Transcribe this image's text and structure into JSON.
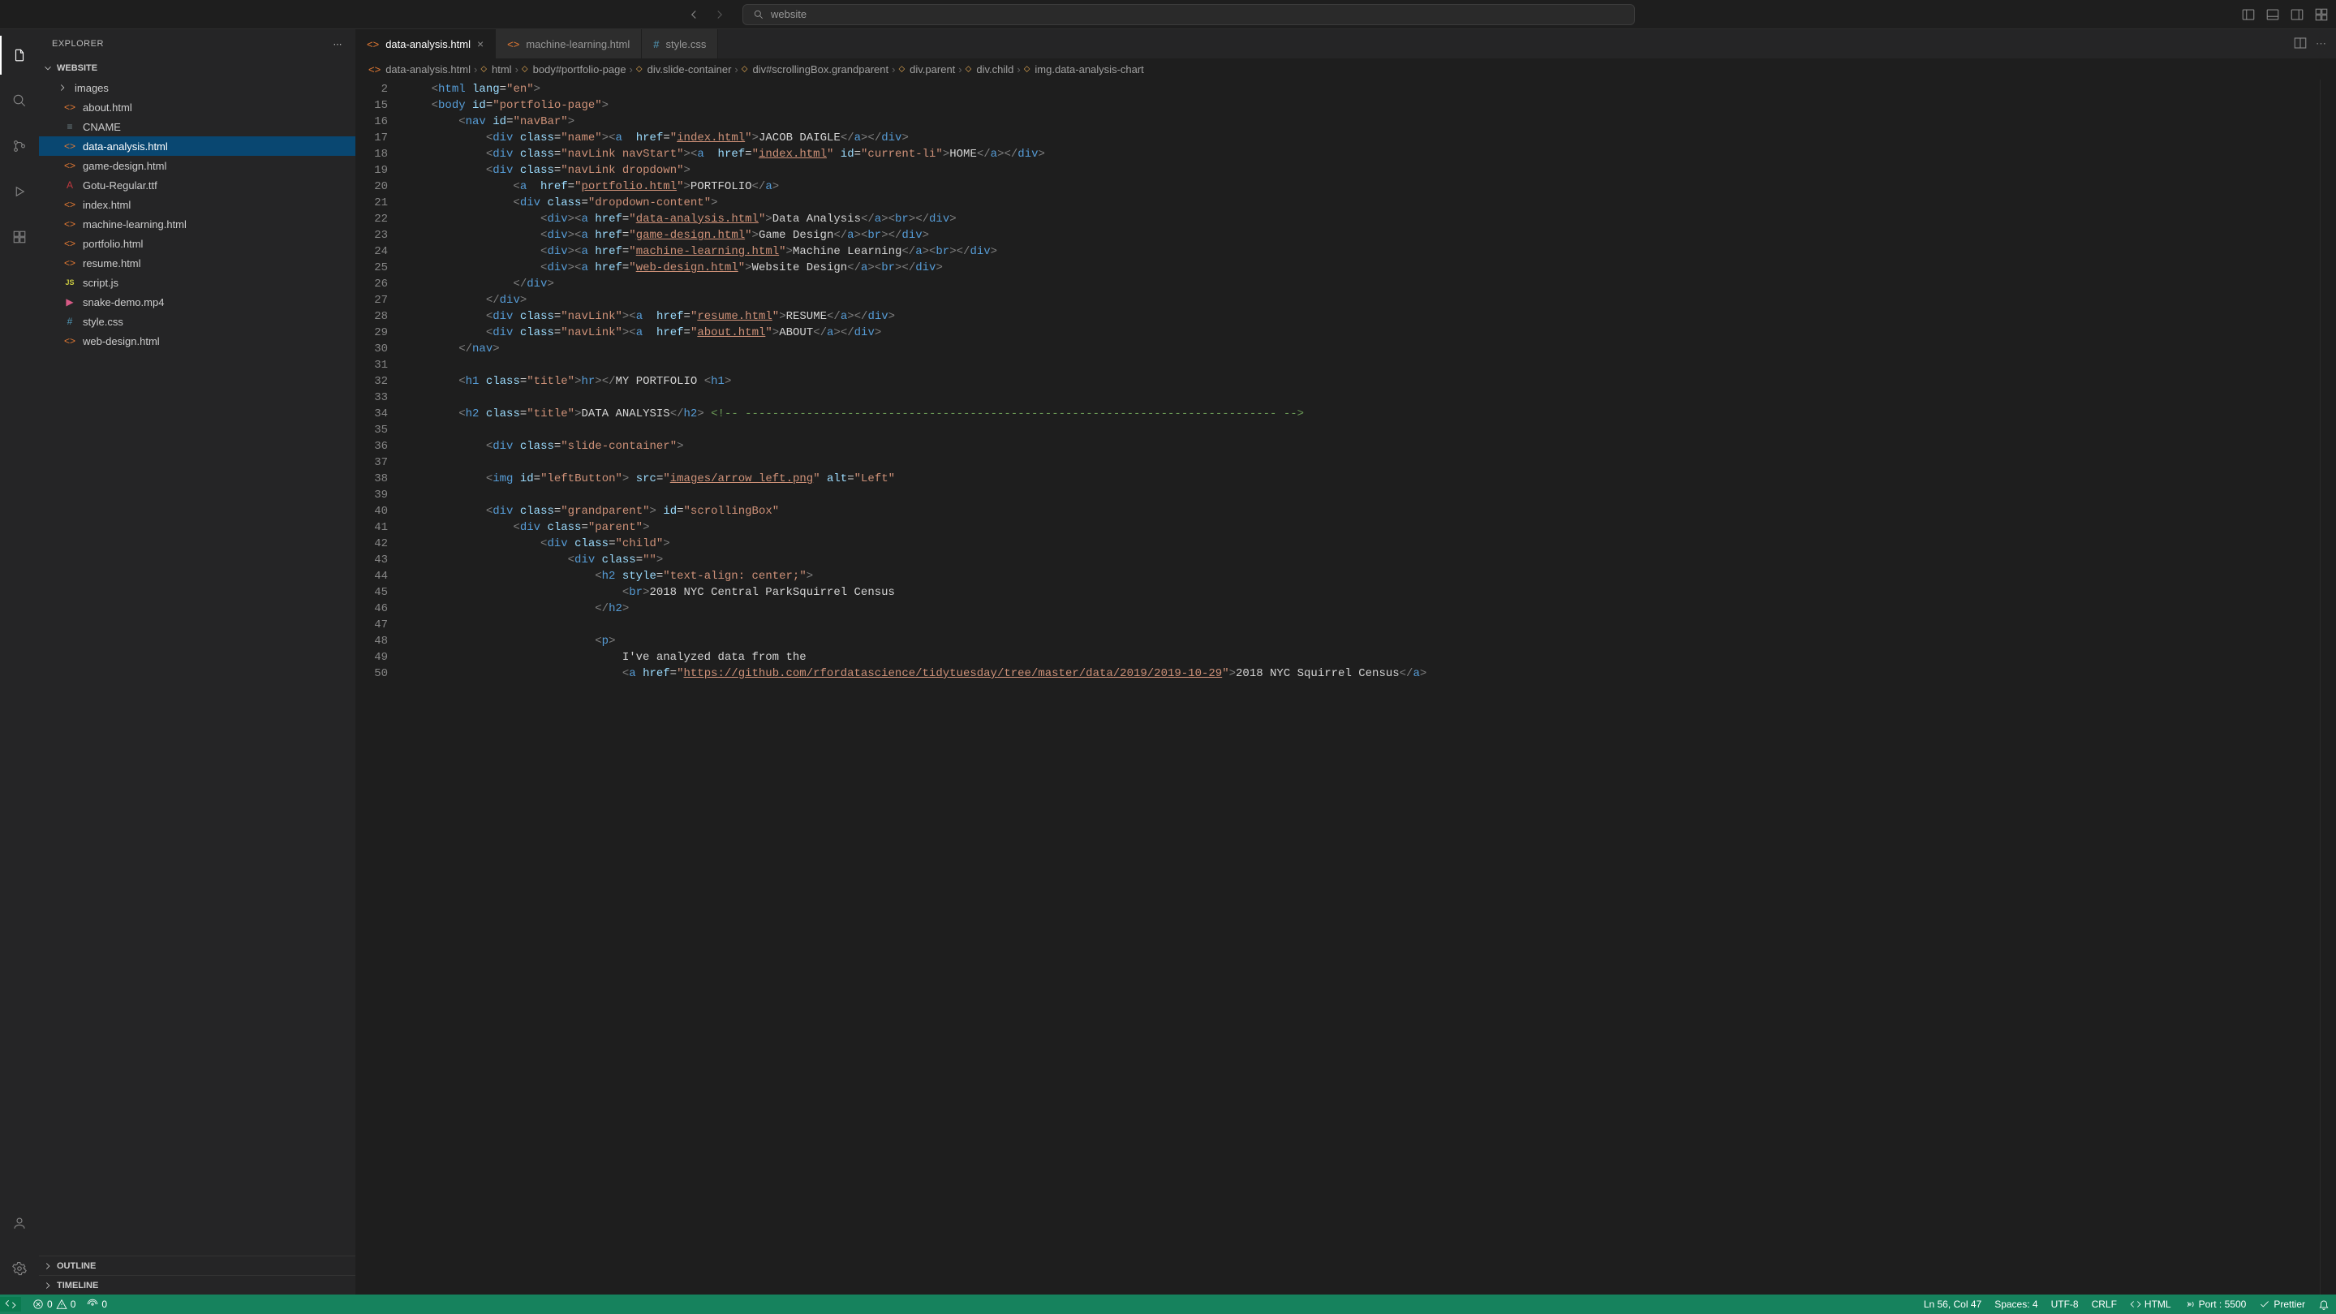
{
  "search_hint": "website",
  "explorer_label": "EXPLORER",
  "project": "WEBSITE",
  "folder_images": "images",
  "files": {
    "about": "about.html",
    "cname": "CNAME",
    "dataanalysis": "data-analysis.html",
    "gamedesign": "game-design.html",
    "gotu": "Gotu-Regular.ttf",
    "index": "index.html",
    "ml": "machine-learning.html",
    "portfolio": "portfolio.html",
    "resume": "resume.html",
    "script": "script.js",
    "snake": "snake-demo.mp4",
    "style": "style.css",
    "webdesign": "web-design.html"
  },
  "outline": "OUTLINE",
  "timeline": "TIMELINE",
  "tabs": {
    "t1": "data-analysis.html",
    "t2": "machine-learning.html",
    "t3": "style.css"
  },
  "breadcrumbs": {
    "b1": "data-analysis.html",
    "b2": "html",
    "b3": "body#portfolio-page",
    "b4": "div.slide-container",
    "b5": "div#scrollingBox.grandparent",
    "b6": "div.parent",
    "b7": "div.child",
    "b8": "img.data-analysis-chart"
  },
  "gutter": [
    "2",
    "15",
    "16",
    "17",
    "18",
    "19",
    "20",
    "21",
    "22",
    "23",
    "24",
    "25",
    "26",
    "27",
    "28",
    "29",
    "30",
    "31",
    "32",
    "33",
    "34",
    "35",
    "36",
    "37",
    "38",
    "39",
    "40",
    "41",
    "42",
    "43",
    "44",
    "45",
    "46",
    "47",
    "48",
    "49",
    "50"
  ],
  "code": {
    "l2": {
      "indent": "    ",
      "open": "<",
      "tag": "html",
      "sp": " ",
      "attr": "lang",
      "eq": "=",
      "val": "\"en\"",
      "close": ">"
    },
    "l15": {
      "indent": "    ",
      "open": "<",
      "tag": "body",
      "sp": " ",
      "attr": "id",
      "eq": "=",
      "val": "\"portfolio-page\"",
      "close": ">"
    },
    "l16": {
      "indent": "        ",
      "open": "<",
      "tag": "nav",
      "sp": " ",
      "attr": "id",
      "eq": "=",
      "val": "\"navBar\"",
      "close": ">"
    },
    "l17": {
      "indent": "            ",
      "s1": "<",
      "tag1": "div",
      "sp1": " ",
      "attr1": "class",
      "eq1": "=",
      "val1": "\"name\"",
      "c1": "><",
      "tag2": "a",
      "sp2": "  ",
      "attr2": "href",
      "eq2": "=",
      "val2": "\"",
      "link2": "index.html",
      "valEnd2": "\"",
      "c2": ">",
      "text": "JACOB DAIGLE",
      "close": "</",
      "tagc1": "a",
      "cc1": "></",
      "tagc2": "div",
      "cc2": ">"
    },
    "l18": {
      "indent": "            ",
      "s1": "<",
      "tag1": "div",
      "sp1": " ",
      "attr1": "class",
      "eq1": "=",
      "val1": "\"navLink navStart\"",
      "c1": "><",
      "tag2": "a",
      "sp2": "  ",
      "attr2": "href",
      "eq2": "=",
      "val2": "\"",
      "link2": "index.html",
      "valEnd2": "\"",
      "sp3": " ",
      "attr3": "id",
      "eq3": "=",
      "val3": "\"current-li\"",
      "c2": ">",
      "text": "HOME",
      "close": "</",
      "tagc1": "a",
      "cc1": "></",
      "tagc2": "div",
      "cc2": ">"
    },
    "l19": {
      "indent": "            ",
      "s1": "<",
      "tag1": "div",
      "sp1": " ",
      "attr1": "class",
      "eq1": "=",
      "val1": "\"navLink dropdown\"",
      "c1": ">"
    },
    "l20": {
      "indent": "                ",
      "s1": "<",
      "tag1": "a",
      "sp1": "  ",
      "attr1": "href",
      "eq1": "=",
      "val1": "\"",
      "link1": "portfolio.html",
      "valEnd1": "\"",
      "c1": ">",
      "text": "PORTFOLIO",
      "close": "</",
      "tagc1": "a",
      "cc1": ">"
    },
    "l21": {
      "indent": "                ",
      "s1": "<",
      "tag1": "div",
      "sp1": " ",
      "attr1": "class",
      "eq1": "=",
      "val1": "\"dropdown-content\"",
      "c1": ">"
    },
    "l22": {
      "indent": "                    ",
      "s1": "<",
      "tag1": "div",
      "c1": "><",
      "tag2": "a",
      "sp2": " ",
      "attr2": "href",
      "eq2": "=",
      "val2": "\"",
      "link2": "data-analysis.html",
      "valEnd2": "\"",
      "c2": ">",
      "text": "Data Analysis",
      "close": "</",
      "tagc1": "a",
      "cc1": "><",
      "tagbr": "br",
      "cbr": "></",
      "tagc2": "div",
      "cc2": ">"
    },
    "l23": {
      "indent": "                    ",
      "s1": "<",
      "tag1": "div",
      "c1": "><",
      "tag2": "a",
      "sp2": " ",
      "attr2": "href",
      "eq2": "=",
      "val2": "\"",
      "link2": "game-design.html",
      "valEnd2": "\"",
      "c2": ">",
      "text": "Game Design",
      "close": "</",
      "tagc1": "a",
      "cc1": "><",
      "tagbr": "br",
      "cbr": "></",
      "tagc2": "div",
      "cc2": ">"
    },
    "l24": {
      "indent": "                    ",
      "s1": "<",
      "tag1": "div",
      "c1": "><",
      "tag2": "a",
      "sp2": " ",
      "attr2": "href",
      "eq2": "=",
      "val2": "\"",
      "link2": "machine-learning.html",
      "valEnd2": "\"",
      "c2": ">",
      "text": "Machine Learning",
      "close": "</",
      "tagc1": "a",
      "cc1": "><",
      "tagbr": "br",
      "cbr": "></",
      "tagc2": "div",
      "cc2": ">"
    },
    "l25": {
      "indent": "                    ",
      "s1": "<",
      "tag1": "div",
      "c1": "><",
      "tag2": "a",
      "sp2": " ",
      "attr2": "href",
      "eq2": "=",
      "val2": "\"",
      "link2": "web-design.html",
      "valEnd2": "\"",
      "c2": ">",
      "text": "Website Design",
      "close": "</",
      "tagc1": "a",
      "cc1": "><",
      "tagbr": "br",
      "cbr": "></",
      "tagc2": "div",
      "cc2": ">"
    },
    "l26": {
      "indent": "                ",
      "s1": "</",
      "tag1": "div",
      "c1": ">"
    },
    "l27": {
      "indent": "            ",
      "s1": "</",
      "tag1": "div",
      "c1": ">"
    },
    "l28": {
      "indent": "            ",
      "s1": "<",
      "tag1": "div",
      "sp1": " ",
      "attr1": "class",
      "eq1": "=",
      "val1": "\"navLink\"",
      "c1": "><",
      "tag2": "a",
      "sp2": "  ",
      "attr2": "href",
      "eq2": "=",
      "val2": "\"",
      "link2": "resume.html",
      "valEnd2": "\"",
      "c2": ">",
      "text": "RESUME",
      "close": "</",
      "tagc1": "a",
      "cc1": "></",
      "tagc2": "div",
      "cc2": ">"
    },
    "l29": {
      "indent": "            ",
      "s1": "<",
      "tag1": "div",
      "sp1": " ",
      "attr1": "class",
      "eq1": "=",
      "val1": "\"navLink\"",
      "c1": "><",
      "tag2": "a",
      "sp2": "  ",
      "attr2": "href",
      "eq2": "=",
      "val2": "\"",
      "link2": "about.html",
      "valEnd2": "\"",
      "c2": ">",
      "text": "ABOUT",
      "close": "</",
      "tagc1": "a",
      "cc1": "></",
      "tagc2": "div",
      "cc2": ">"
    },
    "l30": {
      "indent": "        ",
      "s1": "</",
      "tag1": "nav",
      "c1": ">"
    },
    "l32": {
      "indent": "        ",
      "s1": "<",
      "tag1": "h1",
      "sp1": " ",
      "attr1": "class",
      "eq1": "=",
      "val1": "\"title\"",
      "c1": ">",
      "text": "MY PORTFOLIO ",
      "s2": "<",
      "tag2": "hr",
      "c2": "></",
      "tagc1": "h1",
      "cc1": ">"
    },
    "l34": {
      "indent": "        ",
      "s1": "<",
      "tag1": "h2",
      "sp1": " ",
      "attr1": "class",
      "eq1": "=",
      "val1": "\"title\"",
      "c1": ">",
      "text": "DATA ANALYSIS",
      "close": "</",
      "tagc1": "h2",
      "cc1": "> ",
      "comment": "<!-- ------------------------------------------------------------------------------ -->"
    },
    "l36": {
      "indent": "            ",
      "s1": "<",
      "tag1": "div",
      "sp1": " ",
      "attr1": "class",
      "eq1": "=",
      "val1": "\"slide-container\"",
      "c1": ">"
    },
    "l38": {
      "indent": "            ",
      "s1": "<",
      "tag1": "img",
      "sp1": " ",
      "attr1": "id",
      "eq1": "=",
      "val1": "\"leftButton\"",
      "sp2": " ",
      "attr2": "src",
      "eq2": "=",
      "val2": "\"",
      "link2": "images/arrow_left.png",
      "valEnd2": "\"",
      "sp3": " ",
      "attr3": "alt",
      "eq3": "=",
      "val3": "\"Left\"",
      "c1": ">"
    },
    "l40": {
      "indent": "            ",
      "s1": "<",
      "tag1": "div",
      "sp1": " ",
      "attr1": "class",
      "eq1": "=",
      "val1": "\"grandparent\"",
      "sp2": " ",
      "attr2": "id",
      "eq2": "=",
      "val2": "\"scrollingBox\"",
      "c1": ">"
    },
    "l41": {
      "indent": "                ",
      "s1": "<",
      "tag1": "div",
      "sp1": " ",
      "attr1": "class",
      "eq1": "=",
      "val1": "\"parent\"",
      "c1": ">"
    },
    "l42": {
      "indent": "                    ",
      "s1": "<",
      "tag1": "div",
      "sp1": " ",
      "attr1": "class",
      "eq1": "=",
      "val1": "\"child\"",
      "c1": ">"
    },
    "l43": {
      "indent": "                        ",
      "s1": "<",
      "tag1": "div",
      "sp1": " ",
      "attr1": "class",
      "eq1": "=",
      "val1": "\"\"",
      "c1": ">"
    },
    "l44": {
      "indent": "                            ",
      "s1": "<",
      "tag1": "h2",
      "sp1": " ",
      "attr1": "style",
      "eq1": "=",
      "val1": "\"text-align: center;\"",
      "c1": ">"
    },
    "l45": {
      "indent": "                                ",
      "text": "2018 NYC Central Park",
      "s1": "<",
      "tag1": "br",
      "c1": ">",
      "text2": "Squirrel Census"
    },
    "l46": {
      "indent": "                            ",
      "s1": "</",
      "tag1": "h2",
      "c1": ">"
    },
    "l48": {
      "indent": "                            ",
      "s1": "<",
      "tag1": "p",
      "c1": ">"
    },
    "l49": {
      "indent": "                                ",
      "text": "I've analyzed data from the "
    },
    "l50": {
      "indent": "                                ",
      "s1": "<",
      "tag1": "a",
      "sp1": " ",
      "attr1": "href",
      "eq1": "=",
      "val1": "\"",
      "link1": "https://github.com/rfordatascience/tidytuesday/tree/master/data/2019/2019-10-29",
      "valEnd1": "\"",
      "c1": ">",
      "text": "2018 NYC Squirrel Census",
      "close": "</",
      "tagc1": "a",
      "cc1": ">"
    }
  },
  "status": {
    "errors": "0",
    "warnings": "0",
    "radio": "0",
    "lncol": "Ln 56, Col 47",
    "spaces": "Spaces: 4",
    "encoding": "UTF-8",
    "eol": "CRLF",
    "lang": "HTML",
    "port": "Port : 5500",
    "prettier": "Prettier"
  }
}
